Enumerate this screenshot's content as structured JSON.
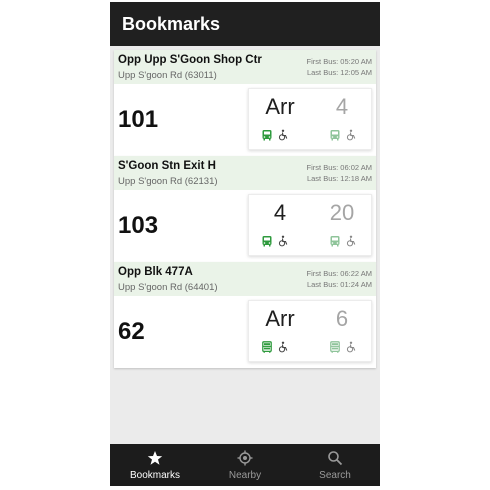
{
  "app": {
    "title": "Bookmarks"
  },
  "colors": {
    "appbar": "#202020",
    "header_bg": "#eaf3e8",
    "accent_green": "#2e9a3d",
    "light_green": "#8fc49a",
    "navbar": "#1c1c1c"
  },
  "bookmarks": [
    {
      "stop_name": "Opp Upp S'Goon Shop Ctr",
      "road": "Upp S'goon Rd (63011)",
      "first_bus": "First Bus: 05:20 AM",
      "last_bus": "Last Bus: 12:05 AM",
      "service": "101",
      "next": "Arr",
      "subsequent": "4",
      "icons": [
        "bus-icon",
        "wheelchair-icon"
      ]
    },
    {
      "stop_name": "S'Goon Stn Exit H",
      "road": "Upp S'goon Rd (62131)",
      "first_bus": "First Bus: 06:02 AM",
      "last_bus": "Last Bus: 12:18 AM",
      "service": "103",
      "next": "4",
      "subsequent": "20",
      "icons": [
        "bus-icon",
        "wheelchair-icon"
      ]
    },
    {
      "stop_name": "Opp Blk 477A",
      "road": "Upp S'goon Rd (64401)",
      "first_bus": "First Bus: 06:22 AM",
      "last_bus": "Last Bus: 01:24 AM",
      "service": "62",
      "next": "Arr",
      "subsequent": "6",
      "icons": [
        "double-deck-bus-icon",
        "wheelchair-icon"
      ]
    }
  ],
  "nav": [
    {
      "label": "Bookmarks",
      "icon": "star-icon",
      "active": true
    },
    {
      "label": "Nearby",
      "icon": "location-target-icon",
      "active": false
    },
    {
      "label": "Search",
      "icon": "search-icon",
      "active": false
    }
  ]
}
